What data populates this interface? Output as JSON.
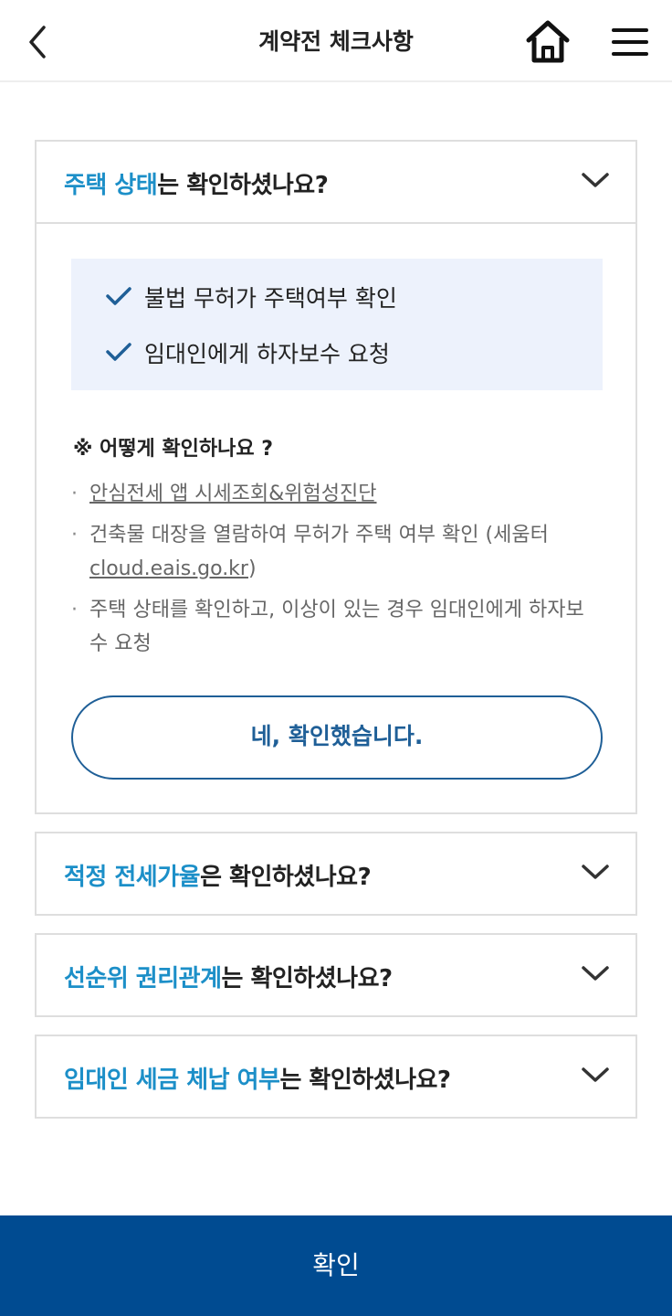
{
  "header": {
    "title": "계약전 체크사항",
    "icons": {
      "back": "chevron-left-icon",
      "home": "home-icon",
      "menu": "hamburger-menu-icon"
    }
  },
  "cards": [
    {
      "highlight": "주택 상태",
      "rest": "는 확인하셨나요?",
      "expanded": true,
      "checklist": [
        "불법 무허가 주택여부 확인",
        "임대인에게 하자보수 요청"
      ],
      "how_title": "※ 어떻게 확인하나요 ?",
      "bullets": {
        "b1_link": "안심전세 앱 시세조회&위험성진단",
        "b2_text": "건축물 대장을 열람하여 무허가 주택 여부 확인 (세움터",
        "b2_link": "cloud.eais.go.kr",
        "b2_tail": ")",
        "b3_text": "주택 상태를 확인하고, 이상이 있는 경우 임대인에게 하자보수 요청"
      },
      "confirm_label": "네, 확인했습니다."
    },
    {
      "highlight": "적정 전세가율",
      "rest": "은 확인하셨나요?",
      "expanded": false
    },
    {
      "highlight": "선순위 권리관계",
      "rest": "는 확인하셨나요?",
      "expanded": false
    },
    {
      "highlight": "임대인 세금 체납 여부",
      "rest": "는 확인하셨나요?",
      "expanded": false
    }
  ],
  "footer": {
    "confirm_label": "확인"
  },
  "colors": {
    "highlight": "#1c8fc8",
    "primary": "#004b91",
    "pill_border": "#1f5f97",
    "checklist_bg": "#edf2fc",
    "check_icon": "#1f5f97"
  }
}
